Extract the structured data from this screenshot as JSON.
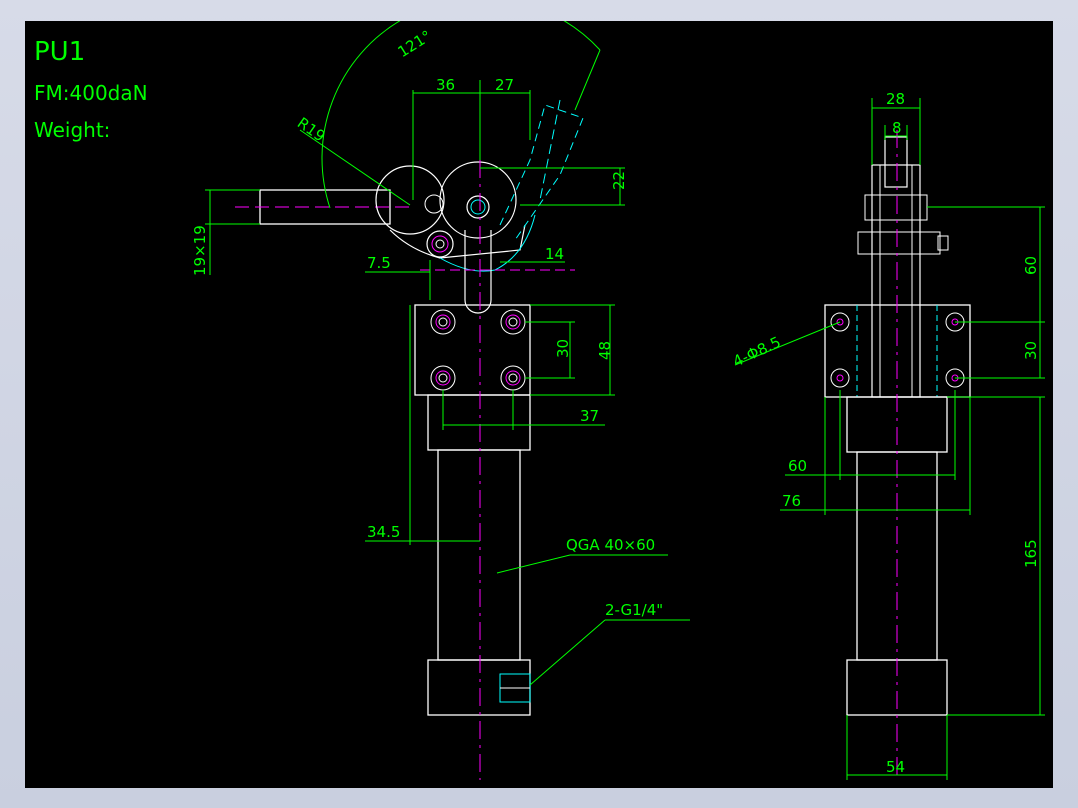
{
  "title_block": {
    "model": "PU1",
    "force": "FM:400daN",
    "weight": "Weight:"
  },
  "dimensions": {
    "angle": "121°",
    "radius": "R19",
    "d36": "36",
    "d27": "27",
    "d22": "22",
    "handle": "19×19",
    "d7_5": "7.5",
    "d14": "14",
    "d30": "30",
    "d48": "48",
    "d37": "37",
    "d34_5": "34.5",
    "cylinder": "QGA 40×60",
    "port": "2-G1/4\"",
    "side_d28": "28",
    "side_d8": "8",
    "holes": "4-Φ8.5",
    "side_d60": "60",
    "side_d30": "30",
    "side_w60": "60",
    "side_w76": "76",
    "side_d165": "165",
    "side_d54": "54"
  },
  "colors": {
    "background": "#000000",
    "outline": "#ffffff",
    "dimension": "#00ff00",
    "centerline": "#ff00ff",
    "hidden": "#00ffff"
  }
}
